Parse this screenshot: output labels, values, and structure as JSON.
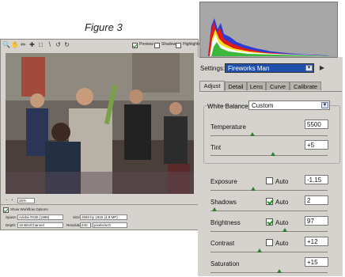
{
  "figure_caption": "Figure 3",
  "left_window": {
    "toolbar_icons": [
      "zoom-icon",
      "hand-icon",
      "eyedropper-icon",
      "color-sampler-icon",
      "crop-icon",
      "straighten-icon",
      "rotate-left-icon",
      "rotate-right-icon"
    ],
    "checkboxes": [
      {
        "label": "Preview",
        "checked": true
      },
      {
        "label": "Shadows",
        "checked": false
      },
      {
        "label": "Highlights",
        "checked": false
      }
    ],
    "zoom_value": "26%",
    "show_workflow_label": "Show Workflow Options",
    "workflow": {
      "space_label": "Space:",
      "space_value": "Adobe RGB (1998)",
      "size_label": "Size:",
      "size_value": "2560 by 1920 (4.9 MP)",
      "depth_label": "Depth:",
      "depth_value": "16 Bits/Channel",
      "resolution_label": "Resolution:",
      "resolution_value": "240",
      "resolution_unit": "pixels/inch"
    }
  },
  "right_panel": {
    "settings_label": "Settings:",
    "settings_value": "Fireworks Man",
    "tabs": [
      "Adjust",
      "Detail",
      "Lens",
      "Curve",
      "Calibrate"
    ],
    "active_tab": "Adjust",
    "white_balance_label": "White Balance:",
    "white_balance_value": "Custom",
    "controls": {
      "temperature": {
        "label": "Temperature",
        "value": "5500"
      },
      "tint": {
        "label": "Tint",
        "value": "+5"
      },
      "exposure": {
        "label": "Exposure",
        "value": "-1.15",
        "auto_label": "Auto",
        "auto": false
      },
      "shadows": {
        "label": "Shadows",
        "value": "2",
        "auto_label": "Auto",
        "auto": true
      },
      "brightness": {
        "label": "Brightness",
        "value": "97",
        "auto_label": "Auto",
        "auto": true
      },
      "contrast": {
        "label": "Contrast",
        "value": "+12",
        "auto_label": "Auto",
        "auto": false
      },
      "saturation": {
        "label": "Saturation",
        "value": "+15"
      }
    }
  },
  "colors": {
    "panel_bg": "#d6d3ce",
    "selection_blue": "#1f4fa8",
    "histogram_bg": "#a7a7a7",
    "slider_thumb": "#2f7f2f"
  }
}
